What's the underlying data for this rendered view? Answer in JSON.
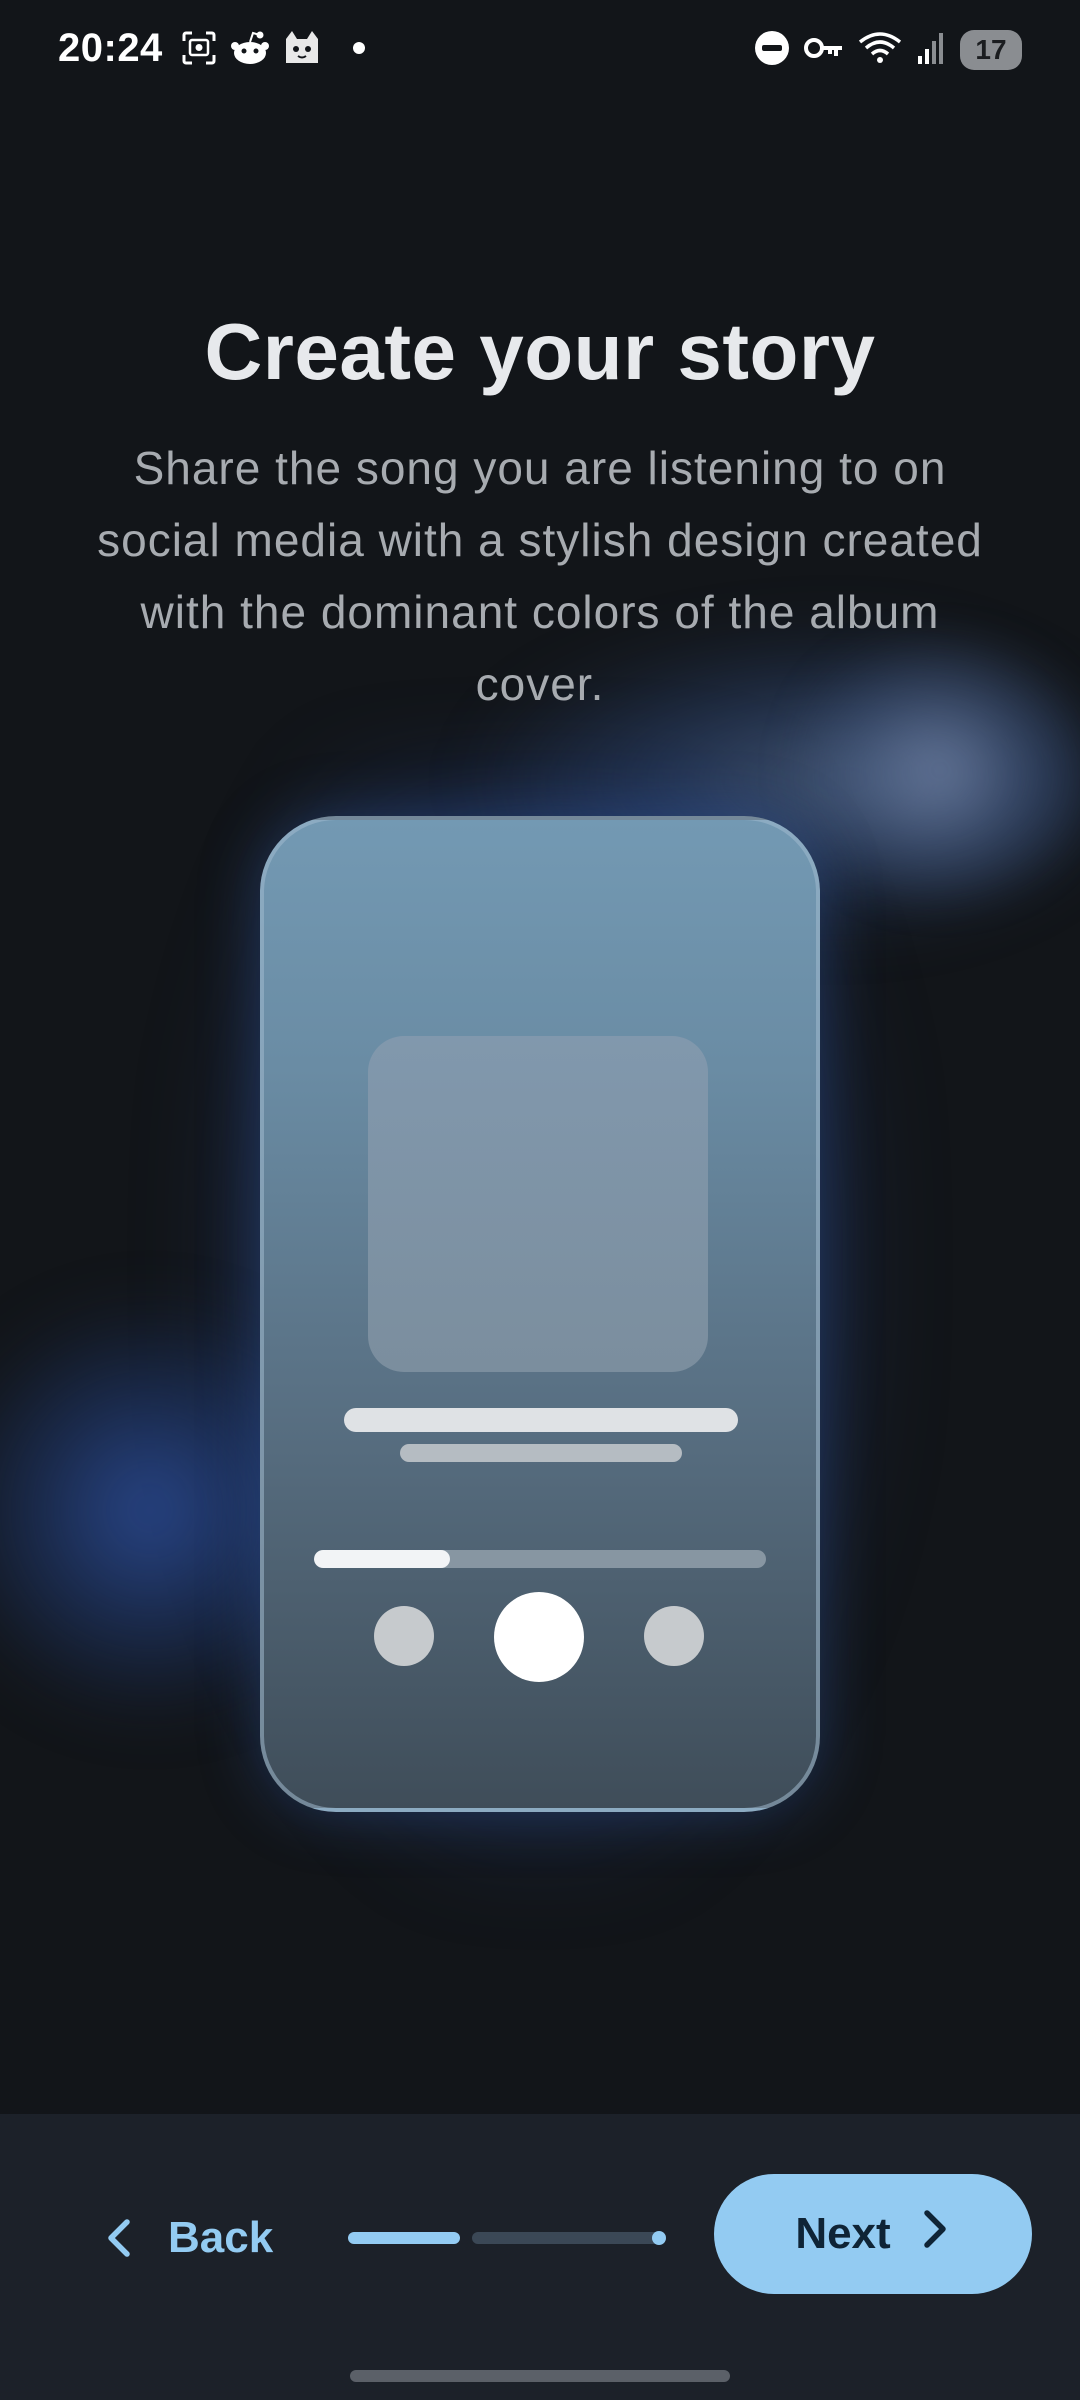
{
  "status_bar": {
    "time": "20:24",
    "left_icons": [
      "screenshot-icon",
      "reddit-icon",
      "cat-app-icon",
      "notification-dot-icon"
    ],
    "right_icons": [
      "do-not-disturb-icon",
      "vpn-key-icon",
      "wifi-icon",
      "signal-icon"
    ],
    "battery": "17"
  },
  "main": {
    "title": "Create your story",
    "description": "Share the song you are listening to on social media with a stylish design created with the dominant colors of the album cover."
  },
  "illustration": {
    "progress": 0.3,
    "controls": [
      "previous-button-shape",
      "play-button-shape",
      "next-button-shape"
    ]
  },
  "footer": {
    "back_label": "Back",
    "next_label": "Next",
    "pager": {
      "current_page": 1,
      "accent_color": "#93cbf2"
    }
  },
  "colors": {
    "background": "#121519",
    "accent": "#93cbf2",
    "bottom_bar": "#1c2129"
  }
}
